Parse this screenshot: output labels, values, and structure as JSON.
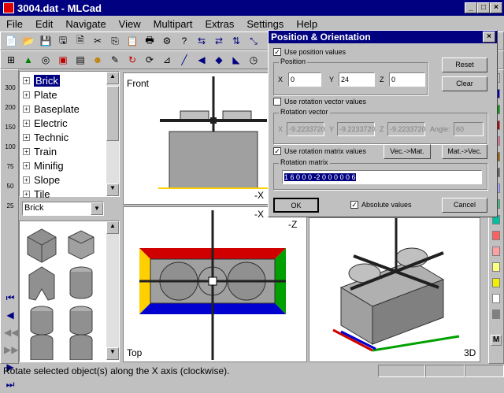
{
  "window": {
    "title": "3004.dat - MLCad"
  },
  "menu": [
    "File",
    "Edit",
    "Navigate",
    "View",
    "Multipart",
    "Extras",
    "Settings",
    "Help"
  ],
  "parts_tree": [
    "Brick",
    "Plate",
    "Baseplate",
    "Electric",
    "Technic",
    "Train",
    "Minifig",
    "Slope",
    "Tile"
  ],
  "left_zoom_labels": [
    "300",
    "200",
    "150",
    "100",
    "75",
    "50",
    "25"
  ],
  "category_select": "Brick",
  "viewports": {
    "front": "Front",
    "top": "Top",
    "view3d": "3D",
    "axis_x": "-X",
    "axis_z": "-Z"
  },
  "dialog": {
    "title": "Position & Orientation",
    "use_position": "Use position values",
    "position_group": "Position",
    "x_label": "X",
    "y_label": "Y",
    "z_label": "Z",
    "pos_x": "0",
    "pos_y": "24",
    "pos_z": "0",
    "reset_label": "Reset",
    "clear_label": "Clear",
    "use_rotation_vector": "Use rotation vector values",
    "rotation_vector_group": "Rotation vector",
    "rv_x": "-9.2233720",
    "rv_y": "-9.2233720",
    "rv_z": "-9.2233720",
    "angle_label": "Angle:",
    "angle_value": "60",
    "use_rotation_matrix": "Use rotation matrix values",
    "vec_to_mat": "Vec.->Mat.",
    "mat_to_vec": "Mat.->Vec.",
    "rotation_matrix_group": "Rotation matrix",
    "matrix_value": "1 6 0 0 0 -2 0 0 0 0 0 6",
    "ok_label": "OK",
    "absolute_values": "Absolute values",
    "cancel_label": "Cancel"
  },
  "status": {
    "text": "Rotate selected object(s) along the X axis (clockwise)."
  },
  "colors": [
    "#c0c0c0",
    "#0000c0",
    "#00a000",
    "#c00000",
    "#e070a0",
    "#f0f000",
    "#ffffff",
    "#808080",
    "#40c080",
    "#ffa0a0",
    "#a06000",
    "#a0a0ff",
    "#ffff80",
    "#606060",
    "#00c0a0",
    "#ff6060"
  ]
}
